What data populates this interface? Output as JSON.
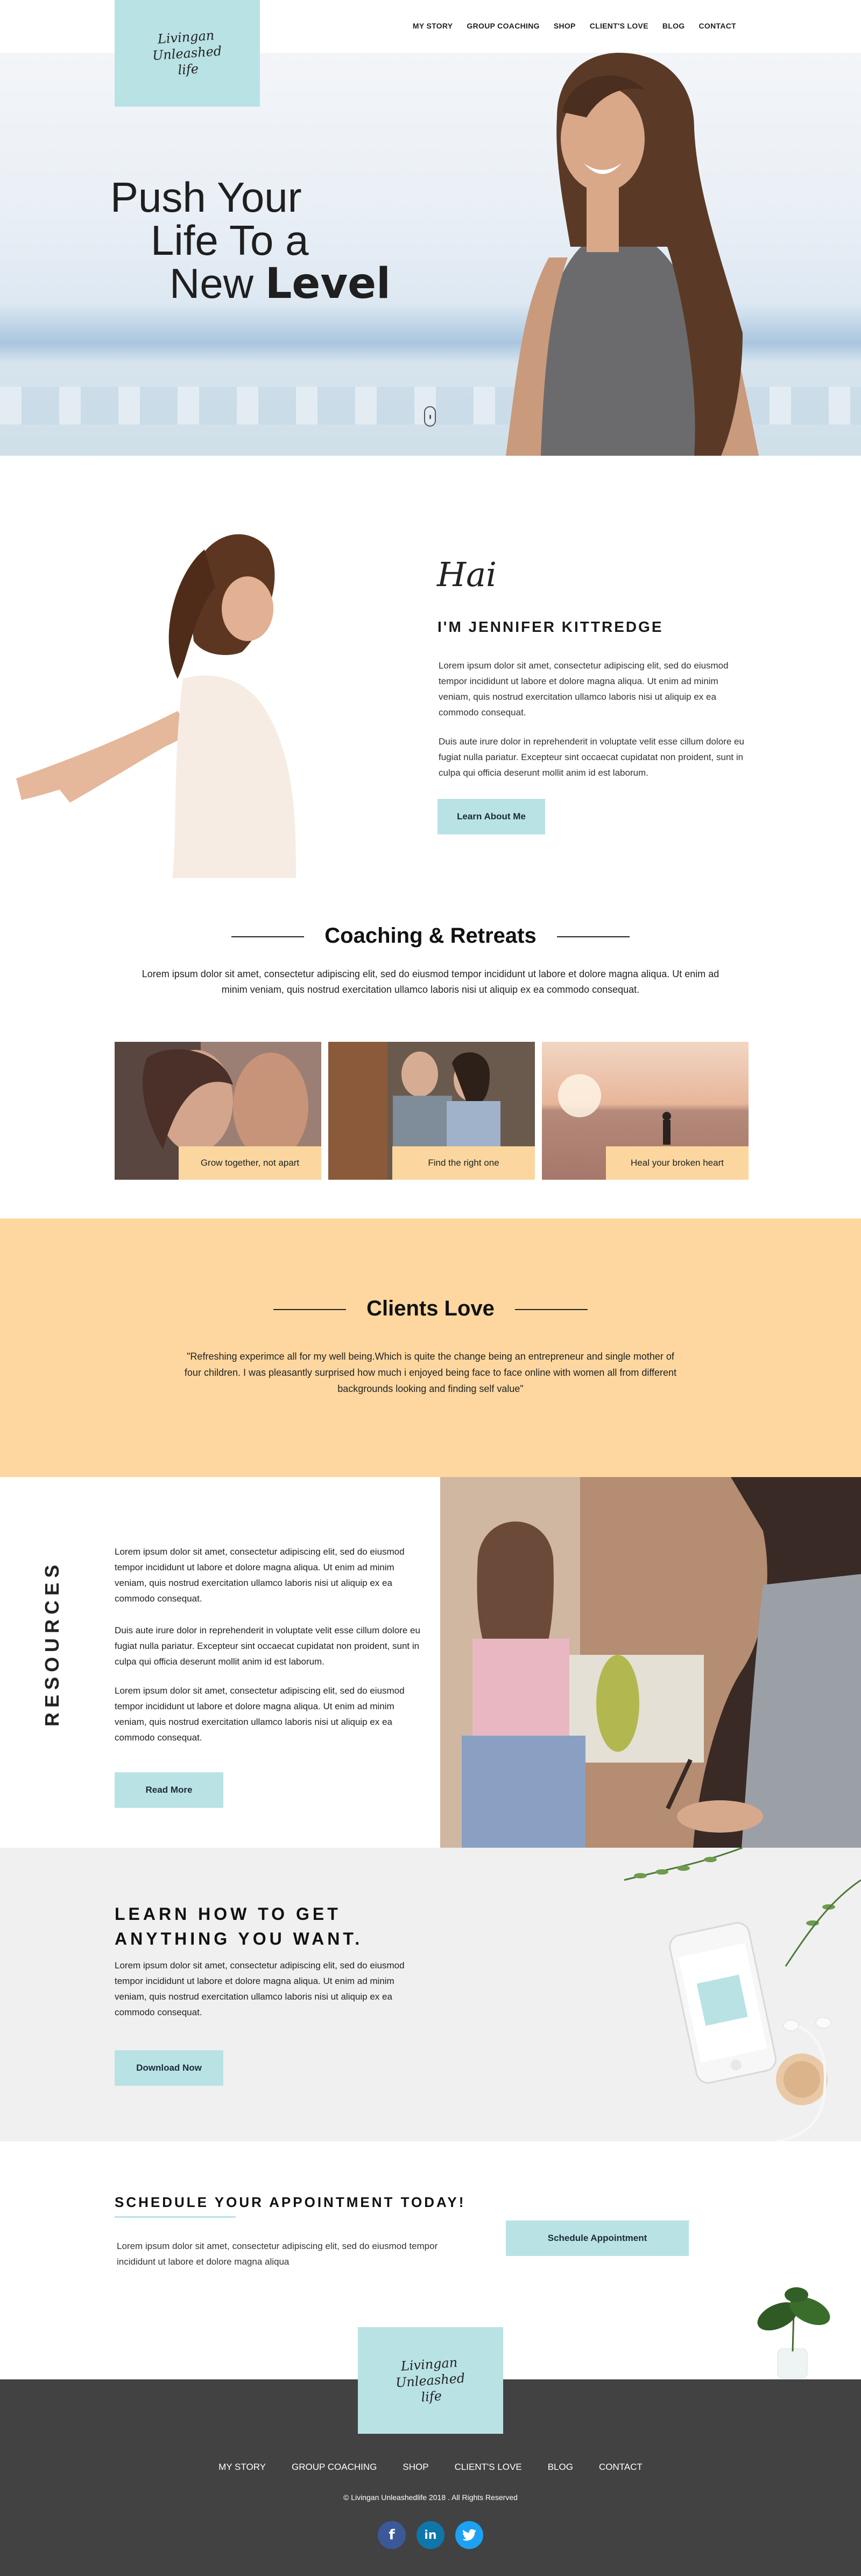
{
  "brand": {
    "logo_line1": "Livingan",
    "logo_line2": "Unleashed",
    "logo_line3": "life"
  },
  "nav": {
    "items": [
      "MY STORY",
      "GROUP COACHING",
      "SHOP",
      "CLIENT'S LOVE",
      "BLOG",
      "CONTACT"
    ]
  },
  "hero": {
    "line1": "Push Your",
    "line2": "Life To a",
    "line3_regular": "New",
    "line3_bold": "Level"
  },
  "about": {
    "greeting": "Hai",
    "name": "I'M  JENNIFER KITTREDGE",
    "para1": "Lorem ipsum dolor sit amet, consectetur adipiscing elit, sed do eiusmod tempor incididunt ut labore et dolore magna aliqua. Ut enim ad minim veniam, quis nostrud exercitation ullamco laboris nisi ut aliquip ex ea commodo consequat.",
    "para2": "Duis aute irure dolor in reprehenderit in voluptate velit esse cillum dolore eu fugiat nulla pariatur. Excepteur sint occaecat cupidatat non proident, sunt in culpa qui officia deserunt mollit anim id est laborum.",
    "button": "Learn About Me"
  },
  "coaching": {
    "title": "Coaching & Retreats",
    "text": "Lorem ipsum dolor sit amet, consectetur adipiscing elit, sed do eiusmod tempor incididunt ut labore et dolore magna aliqua. Ut enim ad minim veniam, quis nostrud exercitation ullamco laboris nisi ut aliquip ex ea commodo consequat.",
    "cards": [
      {
        "label": "Grow together, not apart"
      },
      {
        "label": "Find the right one"
      },
      {
        "label": "Heal your broken heart"
      }
    ]
  },
  "clients": {
    "title": "Clients Love",
    "quote": "\"Refreshing experimce all for my well being.Which is quite the change being an entrepreneur and single mother of four children. I was pleasantly surprised how much i enjoyed being face to face online with women all from different backgrounds looking and finding self value\""
  },
  "resources": {
    "vertical_title": "RESOURCES",
    "para1": "Lorem ipsum dolor sit amet, consectetur adipiscing elit, sed do eiusmod tempor incididunt ut labore et dolore magna aliqua. Ut enim ad minim veniam, quis nostrud exercitation ullamco laboris nisi ut aliquip ex ea commodo consequat.",
    "para2": "Duis aute irure dolor in reprehenderit in voluptate velit esse cillum dolore eu fugiat nulla pariatur. Excepteur sint occaecat cupidatat non proident, sunt in culpa qui officia deserunt mollit anim id est laborum.",
    "para3": "Lorem ipsum dolor sit amet, consectetur adipiscing elit, sed do eiusmod tempor incididunt ut labore et dolore magna aliqua. Ut enim ad minim veniam, quis nostrud exercitation ullamco laboris nisi ut aliquip ex ea commodo consequat.",
    "button": "Read More"
  },
  "learn": {
    "title_line1": "LEARN HOW TO GET",
    "title_line2": "ANYTHING YOU WANT.",
    "text": "Lorem ipsum dolor sit amet, consectetur adipiscing elit, sed do eiusmod tempor incididunt ut labore et dolore magna aliqua. Ut enim ad minim veniam, quis nostrud exercitation ullamco laboris nisi ut aliquip ex ea commodo consequat.",
    "button": "Download Now"
  },
  "schedule": {
    "title": "SCHEDULE YOUR APPOINTMENT TODAY!",
    "text": "Lorem ipsum dolor sit amet, consectetur adipiscing elit, sed do eiusmod tempor incididunt ut labore et dolore magna aliqua",
    "button": "Schedule Appointment"
  },
  "footer": {
    "menu": [
      "MY STORY",
      "GROUP COACHING",
      "SHOP",
      "CLIENT'S LOVE",
      "BLOG",
      "CONTACT"
    ],
    "copyright": "© Livingan Unleashedlife 2018 . All Rights Reserved",
    "social_icons": [
      "facebook-icon",
      "linkedin-icon",
      "twitter-icon"
    ]
  },
  "colors": {
    "accent_teal": "#b9e2e5",
    "peach": "#fdd79f",
    "footer_bg": "#424242",
    "facebook": "#3b5998",
    "linkedin": "#0e76a8",
    "twitter": "#1da1f2"
  }
}
